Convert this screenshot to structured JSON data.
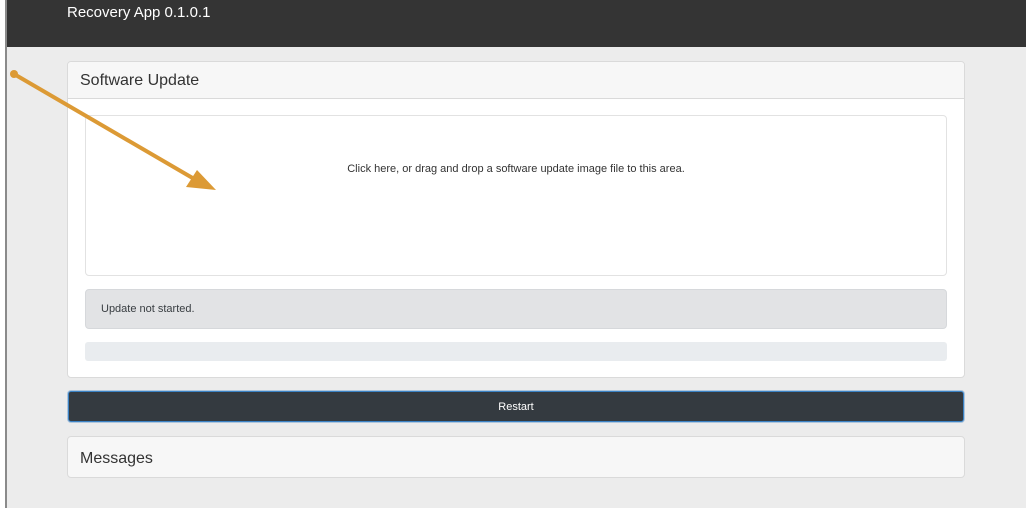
{
  "app": {
    "title": "Recovery App 0.1.0.1"
  },
  "software_update": {
    "title": "Software Update",
    "dropzone_text": "Click here, or drag and drop a software update image file to this area.",
    "status_text": "Update not started.",
    "progress_percent": 0
  },
  "actions": {
    "restart_label": "Restart"
  },
  "messages": {
    "title": "Messages"
  },
  "colors": {
    "navbar": "#343434",
    "annotation_arrow": "#dc9a35",
    "progress_fill": "#007bff"
  },
  "icons": {
    "annotation": "arrow-icon"
  }
}
